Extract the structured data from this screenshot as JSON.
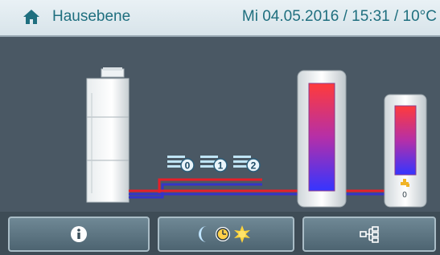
{
  "header": {
    "title": "Hausebene",
    "datetime": "Mi 04.05.2016 / 15:31 /  10°C",
    "home_icon": "home-icon"
  },
  "scene": {
    "fan_levels": [
      "0",
      "1",
      "2"
    ],
    "storage_small_value": "0",
    "colors": {
      "pipe_red": "#e5202a",
      "pipe_blue": "#3535c8",
      "accent": "#1f6f7f"
    }
  },
  "bottom_bar": {
    "buttons": [
      {
        "icon": "info-icon"
      },
      {
        "icon": "night-day-mode-icon"
      },
      {
        "icon": "system-tree-icon"
      }
    ]
  }
}
